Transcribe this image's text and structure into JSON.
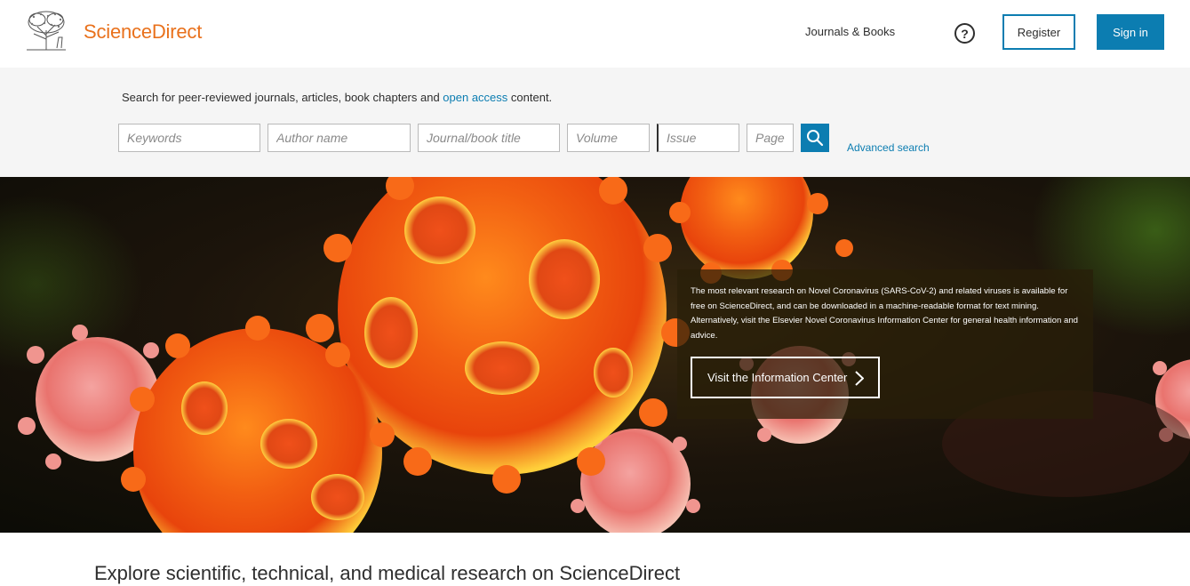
{
  "header": {
    "brand": "ScienceDirect",
    "nav_journals": "Journals & Books",
    "help_symbol": "?",
    "register_label": "Register",
    "signin_label": "Sign in",
    "icons": {
      "logo": "elsevier-tree-logo",
      "help": "question-circle-icon"
    }
  },
  "search": {
    "intro_before": "Search for peer-reviewed journals, articles, book chapters and ",
    "intro_link": "open access",
    "intro_after": " content.",
    "fields": {
      "keywords": "Keywords",
      "author": "Author name",
      "journal": "Journal/book title",
      "volume": "Volume",
      "issue": "Issue",
      "page": "Page"
    },
    "button_icon": "search-icon",
    "advanced_label": "Advanced search"
  },
  "hero": {
    "text": "The most relevant research on Novel Coronavirus (SARS-CoV-2) and related viruses is available for free on ScienceDirect, and can be downloaded in a machine-readable format for text mining. Alternatively, visit the Elsevier Novel Coronavirus Information Center for general health information and advice.",
    "button_label": "Visit the Information Center",
    "button_icon": "chevron-right-icon"
  },
  "explore_heading": "Explore scientific, technical, and medical research on ScienceDirect",
  "colors": {
    "brand_orange": "#e9711c",
    "accent_blue": "#0c7db1",
    "search_band": "#f5f5f5"
  }
}
